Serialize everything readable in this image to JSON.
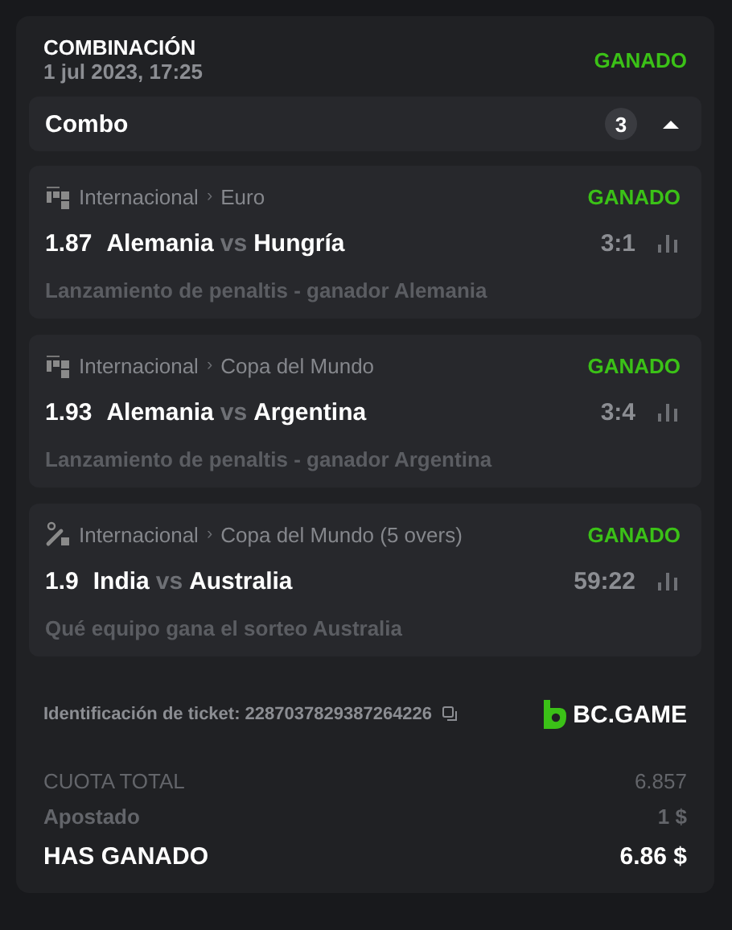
{
  "bet": {
    "title": "COMBINACIÓN",
    "date": "1 jul 2023, 17:25",
    "status": "GANADO"
  },
  "combo": {
    "label": "Combo",
    "count": "3",
    "expanded": true
  },
  "legs": [
    {
      "kind": "penalty",
      "category": "Internacional",
      "separator": "›",
      "league": "Euro",
      "status": "GANADO",
      "odds": "1.87",
      "home": "Alemania",
      "vs": "vs",
      "away": "Hungría",
      "score": "3:1",
      "market": "Lanzamiento de penaltis - ganador Alemania"
    },
    {
      "kind": "penalty",
      "category": "Internacional",
      "separator": "›",
      "league": "Copa del Mundo",
      "status": "GANADO",
      "odds": "1.93",
      "home": "Alemania",
      "vs": "vs",
      "away": "Argentina",
      "score": "3:4",
      "market": "Lanzamiento de penaltis - ganador Argentina"
    },
    {
      "kind": "cricket",
      "category": "Internacional",
      "separator": "›",
      "league": "Copa del Mundo (5 overs)",
      "status": "GANADO",
      "odds": "1.9",
      "home": "India",
      "vs": "vs",
      "away": "Australia",
      "score": "59:22",
      "market": "Qué equipo gana el sorteo Australia"
    }
  ],
  "ticket": {
    "label": "Identificación de ticket: 2287037829387264226",
    "brand": "BC.GAME"
  },
  "summary": [
    {
      "kind": "muted",
      "label": "CUOTA TOTAL",
      "value": "6.857"
    },
    {
      "kind": "semi",
      "label": "Apostado",
      "value": "1 $"
    },
    {
      "kind": "total",
      "label": "HAS GANADO",
      "value": "6.86 $"
    }
  ]
}
